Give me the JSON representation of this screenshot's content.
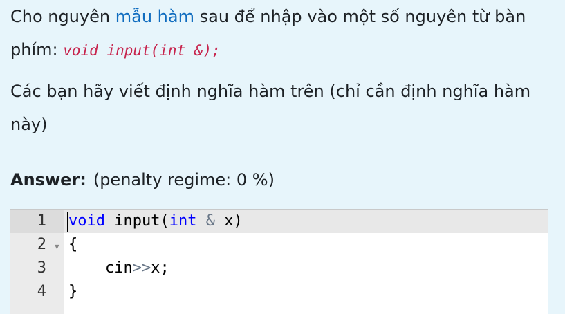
{
  "question": {
    "p1_before": "Cho nguyên ",
    "p1_link": "mẫu hàm",
    "p1_after": " sau để nhập vào một số nguyên từ bàn phím: ",
    "prototype": "void input(int &);",
    "p2": "Các bạn hãy viết định nghĩa hàm trên (chỉ cần định nghĩa hàm này)"
  },
  "answer": {
    "label": "Answer:",
    "penalty": "(penalty regime: 0 %)"
  },
  "editor": {
    "line_numbers": [
      "1",
      "2",
      "3",
      "4"
    ],
    "fold_icon": "▼",
    "line1": {
      "kw1": "void",
      "t1": " input(",
      "kw2": "int",
      "t2": " ",
      "op": "&",
      "t3": " x)"
    },
    "line2": "{",
    "line3": {
      "indent": "    ",
      "t1": "cin",
      "op": ">>",
      "t2": "x;"
    },
    "line4": "}"
  },
  "colors": {
    "background": "#e7f5fb",
    "link": "#0f6cbf",
    "inline_code": "#c7254e",
    "keyword": "#0000ff"
  }
}
